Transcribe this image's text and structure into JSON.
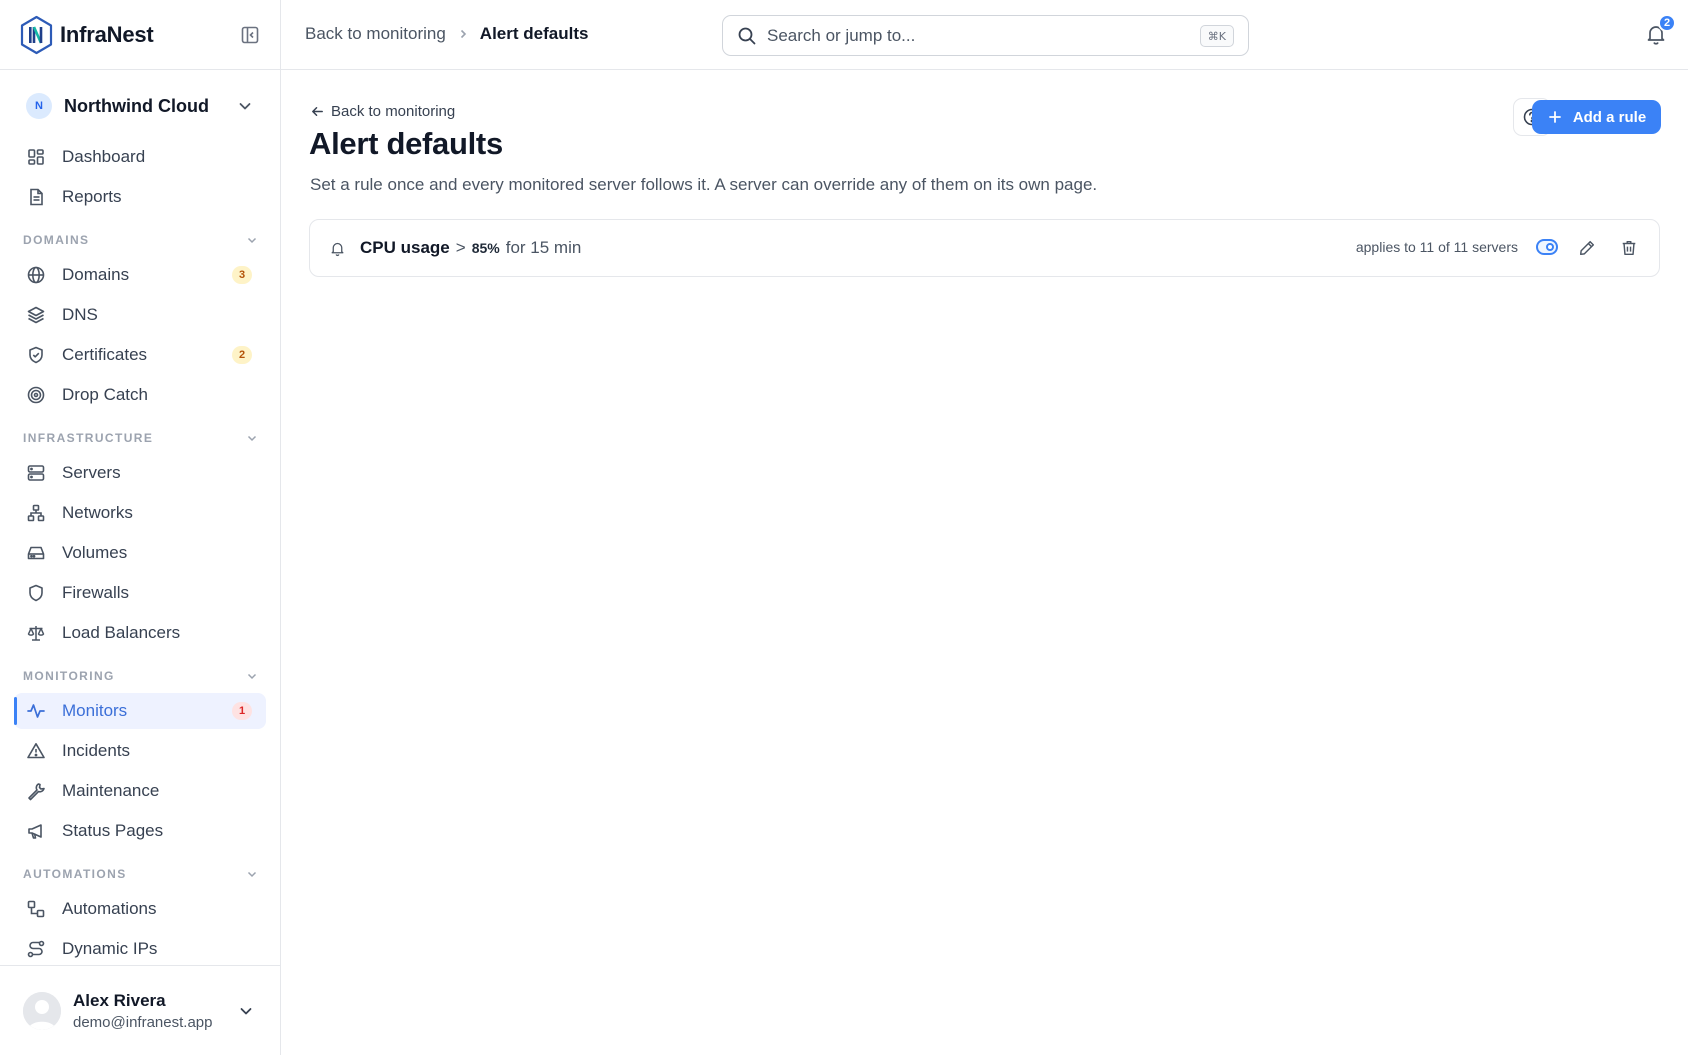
{
  "brand": {
    "name": "InfraNest",
    "logo_icon": "infranest-logo",
    "collapse_icon": "sidebar-collapse-icon"
  },
  "org": {
    "avatar_letter": "N",
    "name": "Northwind Cloud"
  },
  "nav": {
    "top": [
      {
        "label": "Dashboard",
        "icon": "dashboard-icon"
      },
      {
        "label": "Reports",
        "icon": "reports-icon"
      }
    ],
    "sections": [
      {
        "title": "DOMAINS",
        "items": [
          {
            "label": "Domains",
            "icon": "globe-icon",
            "badge": "3",
            "badge_color": "#b45309"
          },
          {
            "label": "DNS",
            "icon": "layers-icon"
          },
          {
            "label": "Certificates",
            "icon": "shield-check-icon",
            "badge": "2",
            "badge_color": "#b45309"
          },
          {
            "label": "Drop Catch",
            "icon": "target-icon"
          }
        ]
      },
      {
        "title": "INFRASTRUCTURE",
        "items": [
          {
            "label": "Servers",
            "icon": "server-icon"
          },
          {
            "label": "Networks",
            "icon": "network-icon"
          },
          {
            "label": "Volumes",
            "icon": "hard-drive-icon"
          },
          {
            "label": "Firewalls",
            "icon": "shield-icon"
          },
          {
            "label": "Load Balancers",
            "icon": "scale-icon"
          }
        ]
      },
      {
        "title": "MONITORING",
        "items": [
          {
            "label": "Monitors",
            "icon": "activity-icon",
            "badge": "1",
            "badge_color": "#dc2626",
            "active": true
          },
          {
            "label": "Incidents",
            "icon": "alert-triangle-icon"
          },
          {
            "label": "Maintenance",
            "icon": "wrench-icon"
          },
          {
            "label": "Status Pages",
            "icon": "megaphone-icon"
          }
        ]
      },
      {
        "title": "AUTOMATIONS",
        "items": [
          {
            "label": "Automations",
            "icon": "workflow-icon"
          },
          {
            "label": "Dynamic IPs",
            "icon": "route-icon"
          }
        ]
      }
    ]
  },
  "user": {
    "name": "Alex Rivera",
    "email": "demo@infranest.app"
  },
  "topbar": {
    "breadcrumb_parent": "Back to monitoring",
    "breadcrumb_current": "Alert defaults",
    "search_placeholder": "Search or jump to...",
    "search_shortcut": "⌘K",
    "notification_count": "2"
  },
  "page": {
    "back_link": "Back to monitoring",
    "title": "Alert defaults",
    "description": "Set a rule once and every monitored server follows it. A server can override any of them on its own page.",
    "add_button": "Add a rule"
  },
  "rules": [
    {
      "metric": "CPU usage",
      "operator": ">",
      "threshold": "85%",
      "duration": "for 15 min",
      "applies": "applies to 11 of 11 servers",
      "enabled": true
    }
  ],
  "colors": {
    "accent": "#3b82f6",
    "active_text": "#3b6fd8",
    "badge_amber": "#b45309",
    "badge_red": "#dc2626"
  }
}
